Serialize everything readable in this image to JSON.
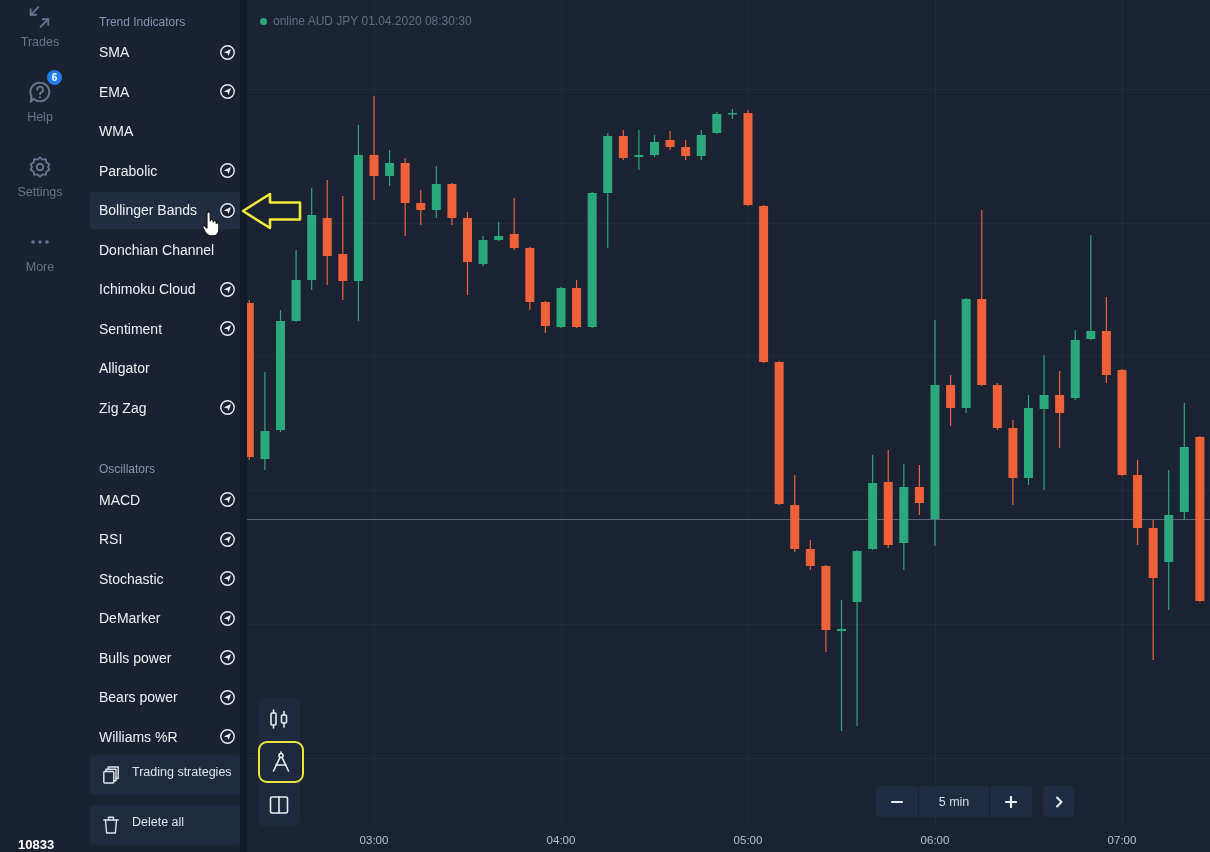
{
  "nav": {
    "items": [
      {
        "label": "Trades"
      },
      {
        "label": "Help",
        "badge": "6"
      },
      {
        "label": "Settings"
      },
      {
        "label": "More"
      }
    ],
    "footer_number": "10833"
  },
  "indicator_menu": {
    "sections": [
      {
        "title": "Trend Indicators",
        "items": [
          {
            "label": "SMA",
            "has_icon": true,
            "highlighted": false
          },
          {
            "label": "EMA",
            "has_icon": true,
            "highlighted": false
          },
          {
            "label": "WMA",
            "has_icon": false,
            "highlighted": false
          },
          {
            "label": "Parabolic",
            "has_icon": true,
            "highlighted": false
          },
          {
            "label": "Bollinger Bands",
            "has_icon": true,
            "highlighted": true
          },
          {
            "label": "Donchian Channel",
            "has_icon": false,
            "highlighted": false
          },
          {
            "label": "Ichimoku Cloud",
            "has_icon": true,
            "highlighted": false
          },
          {
            "label": "Sentiment",
            "has_icon": true,
            "highlighted": false
          },
          {
            "label": "Alligator",
            "has_icon": false,
            "highlighted": false
          },
          {
            "label": "Zig Zag",
            "has_icon": true,
            "highlighted": false
          }
        ]
      },
      {
        "title": "Oscillators",
        "items": [
          {
            "label": "MACD",
            "has_icon": true,
            "highlighted": false
          },
          {
            "label": "RSI",
            "has_icon": true,
            "highlighted": false
          },
          {
            "label": "Stochastic",
            "has_icon": true,
            "highlighted": false
          },
          {
            "label": "DeMarker",
            "has_icon": true,
            "highlighted": false
          },
          {
            "label": "Bulls power",
            "has_icon": true,
            "highlighted": false
          },
          {
            "label": "Bears power",
            "has_icon": true,
            "highlighted": false
          },
          {
            "label": "Williams %R",
            "has_icon": true,
            "highlighted": false
          }
        ]
      }
    ],
    "buttons": [
      {
        "label": "Trading strategies"
      },
      {
        "label": "Delete all"
      }
    ]
  },
  "chart": {
    "status_text": "online AUD JPY 01.04.2020 08:30:30",
    "time_labels": [
      "03:00",
      "04:00",
      "05:00",
      "06:00",
      "07:00"
    ]
  },
  "chart_tools": [
    {
      "highlighted": false
    },
    {
      "highlighted": true
    },
    {
      "highlighted": false
    }
  ],
  "timeframe": {
    "label": "5 min"
  }
}
